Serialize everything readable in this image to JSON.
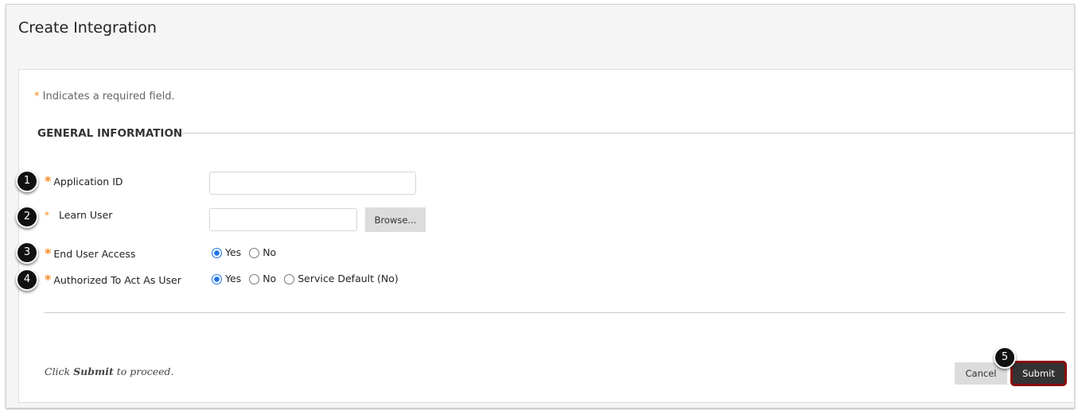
{
  "header": {
    "title": "Create Integration"
  },
  "form": {
    "required_note": "Indicates a required field.",
    "required_marker": "*",
    "section_title": "GENERAL INFORMATION",
    "fields": [
      {
        "step": "1",
        "label": "Application ID",
        "value": ""
      },
      {
        "step": "2",
        "label": "Learn User",
        "value": "",
        "browse_label": "Browse..."
      },
      {
        "step": "3",
        "label": "End User Access",
        "options": [
          "Yes",
          "No"
        ],
        "selected": "Yes"
      },
      {
        "step": "4",
        "label": "Authorized To Act As User",
        "options": [
          "Yes",
          "No",
          "Service Default (No)"
        ],
        "selected": "Yes"
      }
    ]
  },
  "footer": {
    "note_prefix": "Click ",
    "note_bold": "Submit",
    "note_suffix": " to proceed.",
    "cancel_label": "Cancel",
    "submit_label": "Submit",
    "submit_step": "5"
  },
  "colors": {
    "required": "#f7881e",
    "radio_selected": "#1a73e8",
    "submit_highlight": "#8b0a0a"
  }
}
